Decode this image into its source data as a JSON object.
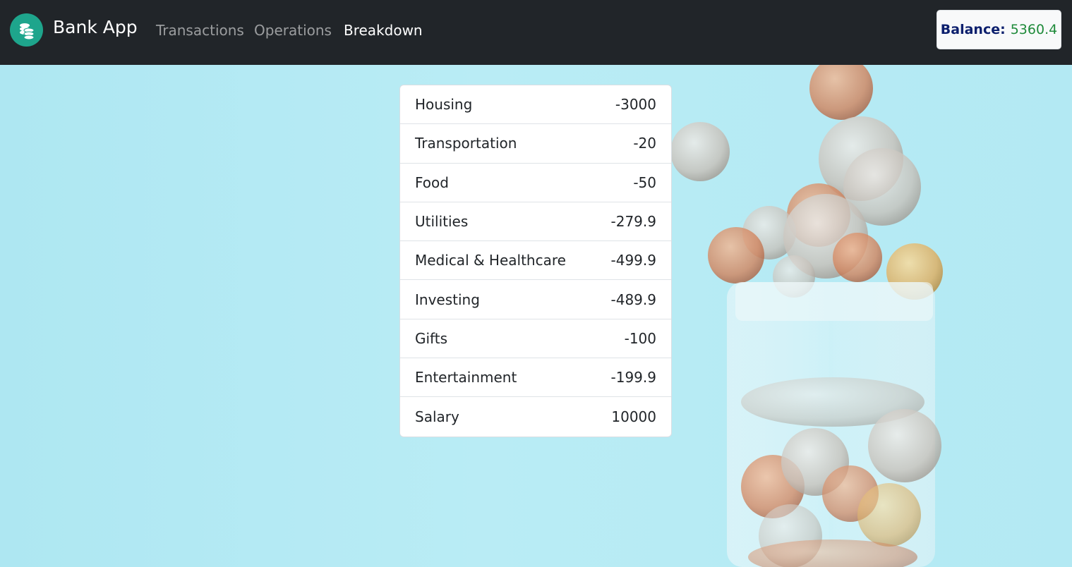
{
  "navbar": {
    "brand": "Bank App",
    "links": [
      {
        "label": "Transactions",
        "active": false
      },
      {
        "label": "Operations",
        "active": false
      },
      {
        "label": "Breakdown",
        "active": true
      }
    ],
    "balance_label": "Balance:",
    "balance_value": "5360.4",
    "logo_icon": "coins-stack-icon"
  },
  "breakdown": {
    "rows": [
      {
        "category": "Housing",
        "amount": "-3000"
      },
      {
        "category": "Transportation",
        "amount": "-20"
      },
      {
        "category": "Food",
        "amount": "-50"
      },
      {
        "category": "Utilities",
        "amount": "-279.9"
      },
      {
        "category": "Medical & Healthcare",
        "amount": "-499.9"
      },
      {
        "category": "Investing",
        "amount": "-489.9"
      },
      {
        "category": "Gifts",
        "amount": "-100"
      },
      {
        "category": "Entertainment",
        "amount": "-199.9"
      },
      {
        "category": "Salary",
        "amount": "10000"
      }
    ]
  },
  "colors": {
    "navbar_bg": "#212529",
    "logo_bg": "#1ea58c",
    "balance_label": "#0c1f6d",
    "balance_value": "#1e8a3a",
    "background": "#b5e9f3"
  }
}
